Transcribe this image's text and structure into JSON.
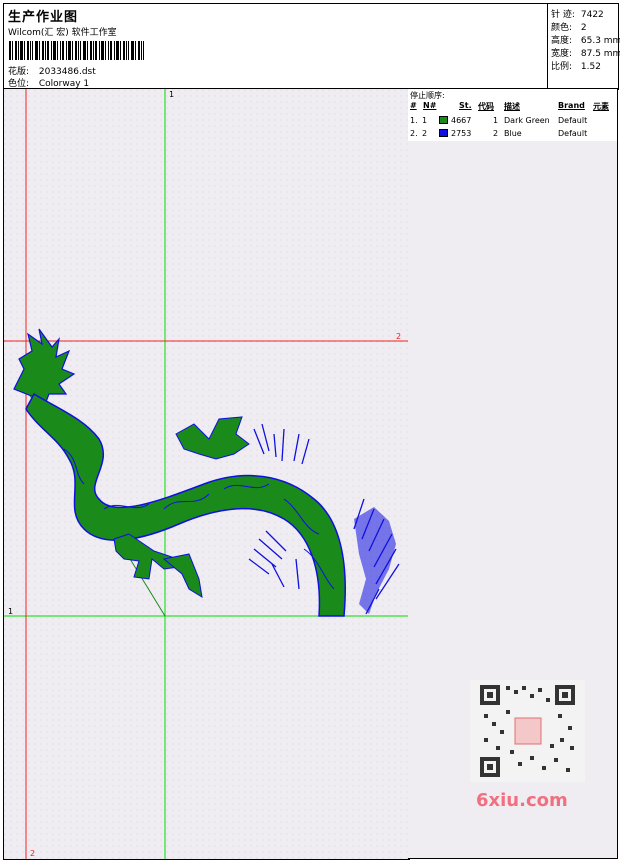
{
  "header": {
    "title": "生产作业图",
    "subtitle": "Wilcom(汇 宏) 软件工作室",
    "design_label": "花版:",
    "design_value": "2033486.dst",
    "colorway_label": "色位:",
    "colorway_value": "Colorway 1"
  },
  "stats": {
    "stitches_label": "针 迹:",
    "stitches_value": "7422",
    "colors_label": "颜色:",
    "colors_value": "2",
    "height_label": "高度:",
    "height_value": "65.3 mm",
    "width_label": "宽度:",
    "width_value": "87.5 mm",
    "ratio_label": "比例:",
    "ratio_value": "1.52"
  },
  "stop_sequence": {
    "title": "停止顺序:",
    "headers": [
      "#",
      "N#",
      "St.",
      "代码",
      "描述",
      "Brand",
      "元素"
    ],
    "rows": [
      {
        "idx": "1.",
        "n": "1",
        "st": "4667",
        "code": "1",
        "desc": "Dark Green",
        "brand": "Default",
        "color": "#1a8a1a"
      },
      {
        "idx": "2.",
        "n": "2",
        "st": "2753",
        "code": "2",
        "desc": "Blue",
        "brand": "Default",
        "color": "#1010e0"
      }
    ]
  },
  "guides": {
    "label_1_top": "1",
    "label_2_right": "2",
    "label_1_left": "1",
    "label_2_bottom": "2"
  },
  "watermark": {
    "site": "6xiu.com"
  },
  "colors": {
    "green_guide": "#00dd00",
    "red_guide": "#ee2222",
    "dragon_green": "#1a8a1a",
    "dragon_blue": "#1010e0"
  }
}
